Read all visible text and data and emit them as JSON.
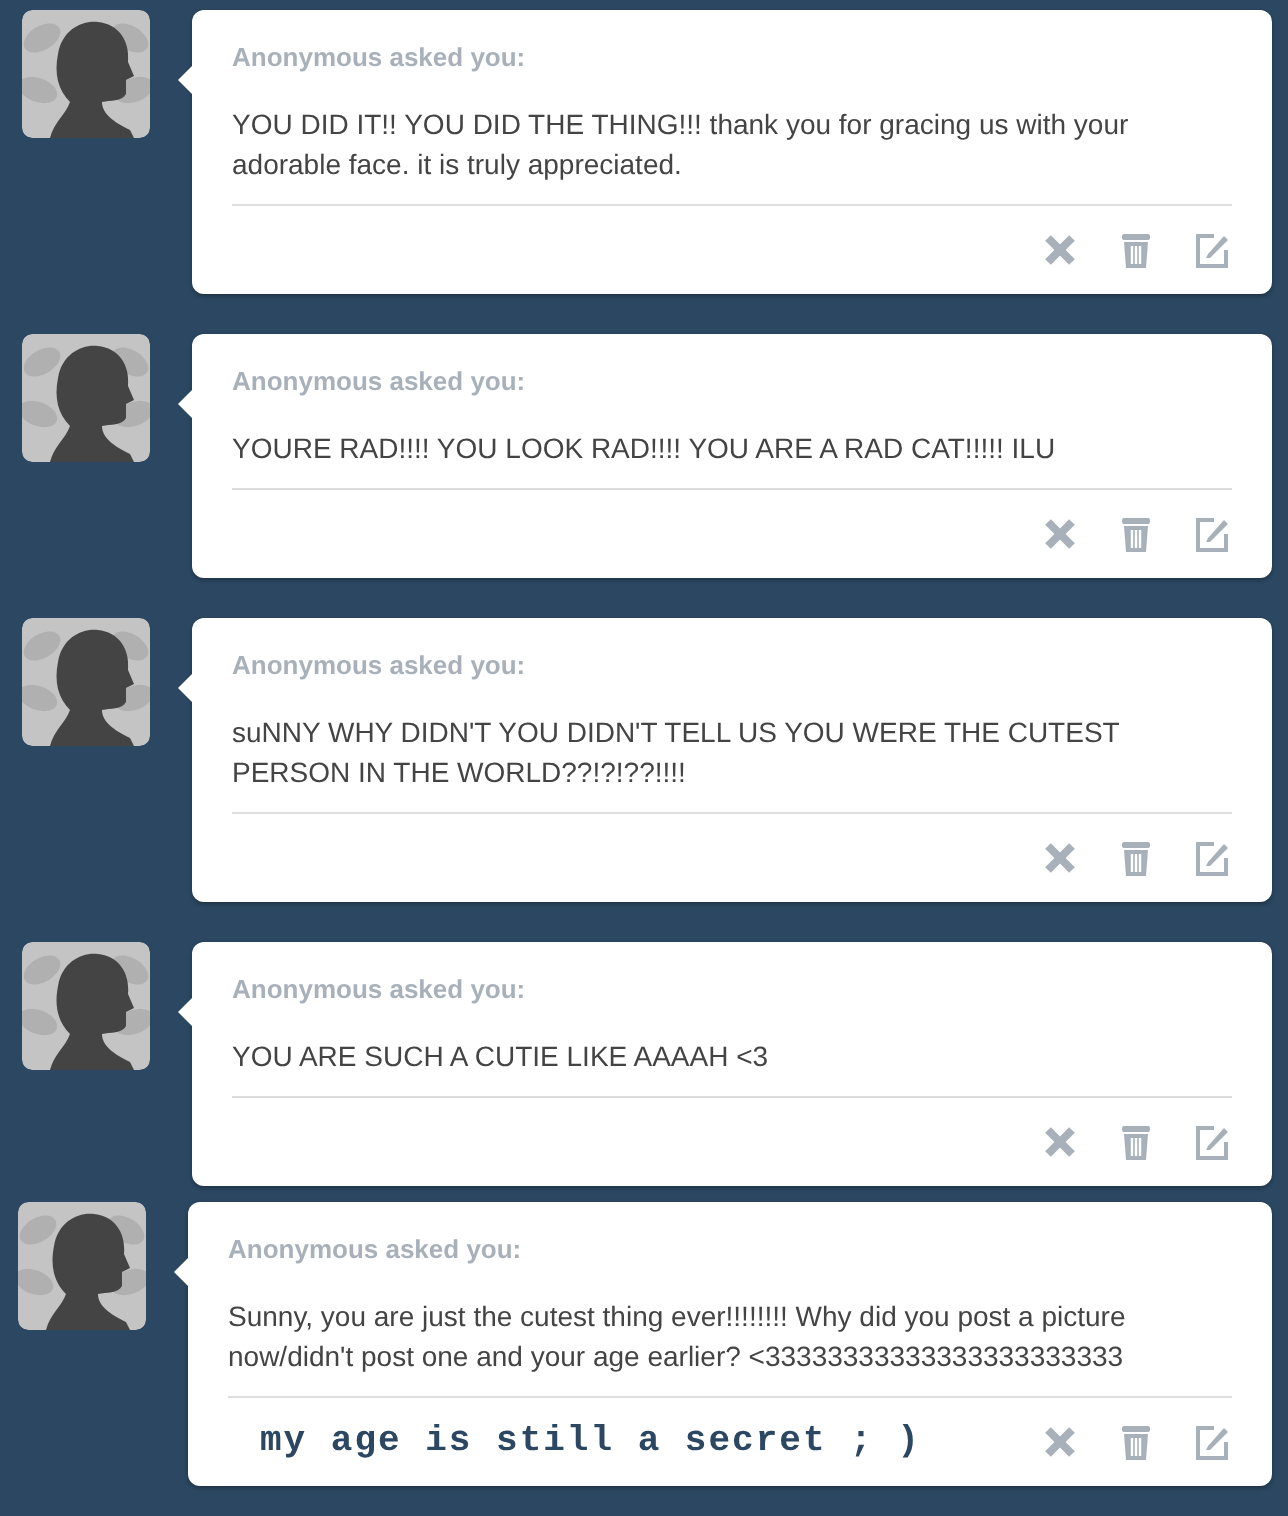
{
  "messages": [
    {
      "asker": "Anonymous asked you:",
      "question": "YOU DID IT!! YOU DID THE THING!!! thank you for gracing us with your adorable face. it is truly appreciated."
    },
    {
      "asker": "Anonymous asked you:",
      "question": "YOURE RAD!!!! YOU LOOK RAD!!!! YOU ARE A RAD CAT!!!!! ILU"
    },
    {
      "asker": "Anonymous asked you:",
      "question": "suNNY WHY DIDN'T YOU DIDN'T TELL US YOU WERE THE CUTEST PERSON IN THE WORLD??!?!??!!!!"
    },
    {
      "asker": "Anonymous asked you:",
      "question": "YOU ARE SUCH A CUTIE LIKE AAAAH <3"
    },
    {
      "asker": "Anonymous asked you:",
      "question": "Sunny, you are just the cutest thing ever!!!!!!!! Why did you post a picture now/didn't post one and your age earlier? <33333333333333333333333",
      "reply": "my age is still a secret ; )"
    }
  ]
}
